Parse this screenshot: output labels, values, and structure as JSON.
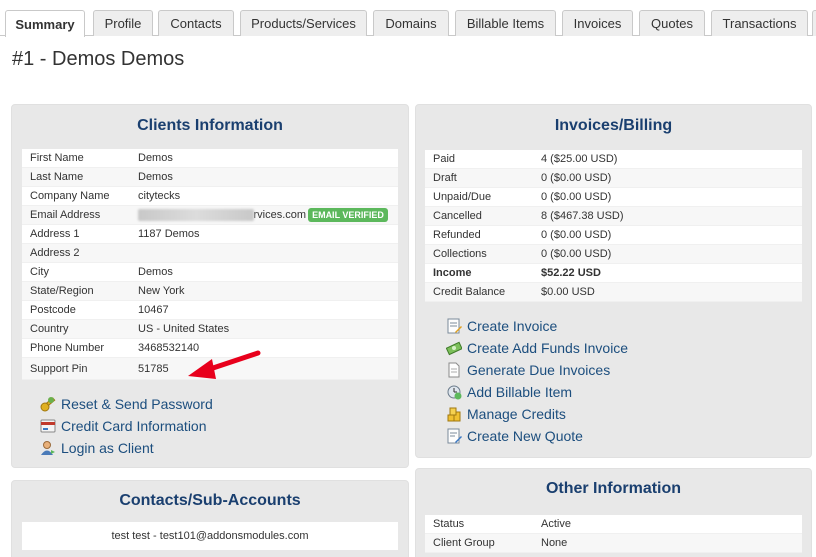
{
  "tabs": [
    "Summary",
    "Profile",
    "Contacts",
    "Products/Services",
    "Domains",
    "Billable Items",
    "Invoices",
    "Quotes",
    "Transactions"
  ],
  "page_title": "#1 - Demos Demos",
  "clients_info": {
    "title": "Clients Information",
    "rows": [
      {
        "label": "First Name",
        "value": "Demos"
      },
      {
        "label": "Last Name",
        "value": "Demos"
      },
      {
        "label": "Company Name",
        "value": "citytecks"
      },
      {
        "label": "Email Address",
        "value": "rvices.com",
        "badge": "EMAIL VERIFIED"
      },
      {
        "label": "Address 1",
        "value": "1187 Demos"
      },
      {
        "label": "Address 2",
        "value": ""
      },
      {
        "label": "City",
        "value": "Demos"
      },
      {
        "label": "State/Region",
        "value": "New York"
      },
      {
        "label": "Postcode",
        "value": "10467"
      },
      {
        "label": "Country",
        "value": "US - United States"
      },
      {
        "label": "Phone Number",
        "value": "3468532140"
      },
      {
        "label": "Support Pin",
        "value": "51785"
      }
    ],
    "actions": [
      "Reset & Send Password",
      "Credit Card Information",
      "Login as Client"
    ]
  },
  "invoices_billing": {
    "title": "Invoices/Billing",
    "rows": [
      {
        "label": "Paid",
        "value": "4 ($25.00 USD)"
      },
      {
        "label": "Draft",
        "value": "0 ($0.00 USD)"
      },
      {
        "label": "Unpaid/Due",
        "value": "0 ($0.00 USD)"
      },
      {
        "label": "Cancelled",
        "value": "8 ($467.38 USD)"
      },
      {
        "label": "Refunded",
        "value": "0 ($0.00 USD)"
      },
      {
        "label": "Collections",
        "value": "0 ($0.00 USD)"
      },
      {
        "label": "Income",
        "value": "$52.22 USD"
      },
      {
        "label": "Credit Balance",
        "value": "$0.00 USD"
      }
    ],
    "actions": [
      "Create Invoice",
      "Create Add Funds Invoice",
      "Generate Due Invoices",
      "Add Billable Item",
      "Manage Credits",
      "Create New Quote"
    ]
  },
  "contacts": {
    "title": "Contacts/Sub-Accounts",
    "line": "test test - test101@addonsmodules.com"
  },
  "other_info": {
    "title": "Other Information",
    "rows": [
      {
        "label": "Status",
        "value": "Active"
      },
      {
        "label": "Client Group",
        "value": "None"
      }
    ]
  },
  "colors": {
    "accent": "#1a3f6f",
    "link": "#1c4e7e",
    "verified": "#5cb85c",
    "arrow": "#e8001c",
    "panel": "#e8e8e8"
  },
  "icons": {
    "client_actions": [
      "key-icon",
      "credit-card-icon",
      "user-login-icon"
    ],
    "billing_actions": [
      "invoice-icon",
      "money-icon",
      "document-icon",
      "billable-item-icon",
      "coins-icon",
      "quote-icon"
    ]
  }
}
